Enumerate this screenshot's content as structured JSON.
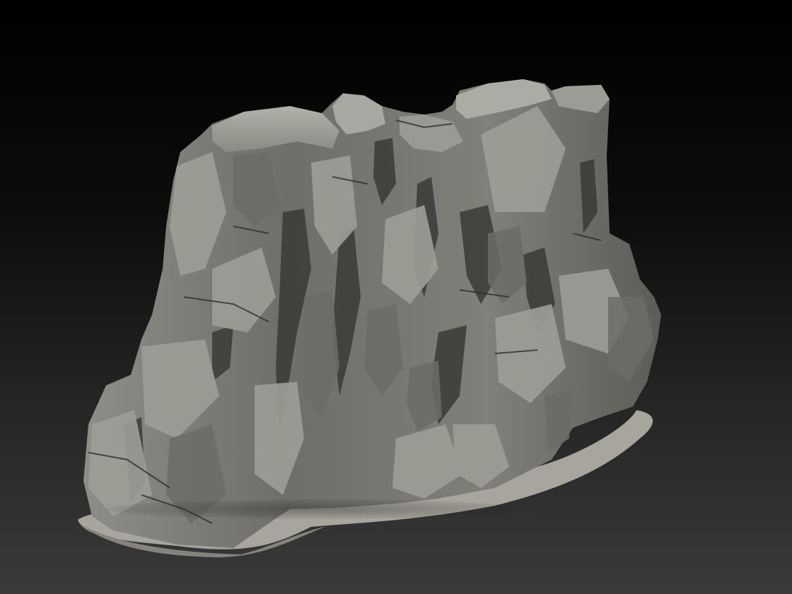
{
  "scene": {
    "subject_icon": "rock-cliff-icon",
    "colors": {
      "background_top": "#000000",
      "background_bottom": "#3a3a3a",
      "rock_light": "#a4a39c",
      "rock_mid": "#7b7a74",
      "rock_dark": "#4a4945",
      "rock_shadow": "#2c2b29",
      "base_plate": "#a8a59c"
    }
  }
}
